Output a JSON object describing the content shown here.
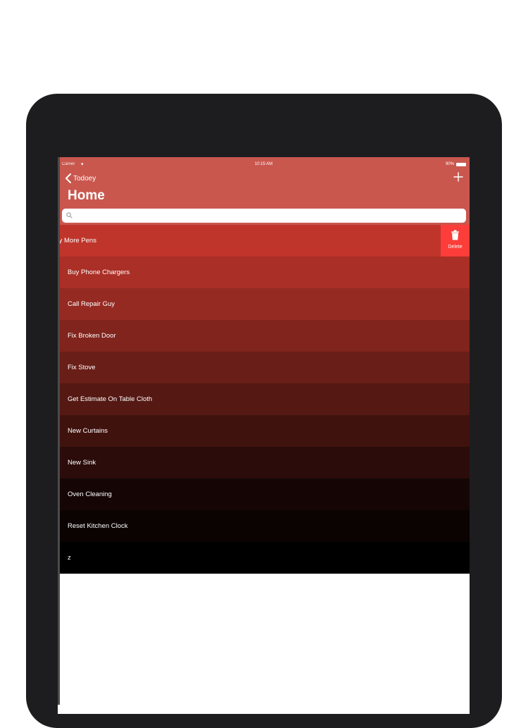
{
  "status_bar": {
    "carrier": "Carrier",
    "time": "10:15 AM",
    "battery": "90%"
  },
  "nav": {
    "back_label": "Todoey",
    "title": "Home"
  },
  "search": {
    "placeholder": "",
    "value": ""
  },
  "row_action": {
    "delete_label": "Delete"
  },
  "items": [
    {
      "label": "Buy More Pens",
      "color": "#c0352b"
    },
    {
      "label": "Buy Phone Chargers",
      "color": "#aa2f26"
    },
    {
      "label": "Call Repair Guy",
      "color": "#952a22"
    },
    {
      "label": "Fix Broken Door",
      "color": "#80241d"
    },
    {
      "label": "Fix Stove",
      "color": "#6a1e18"
    },
    {
      "label": "Get Estimate On Table Cloth",
      "color": "#551813"
    },
    {
      "label": "New Curtains",
      "color": "#40120e"
    },
    {
      "label": "New Sink",
      "color": "#2b0c0a"
    },
    {
      "label": "Oven Cleaning",
      "color": "#150605"
    },
    {
      "label": "Reset Kitchen Clock",
      "color": "#0a0302"
    },
    {
      "label": "z",
      "color": "#000000"
    }
  ]
}
